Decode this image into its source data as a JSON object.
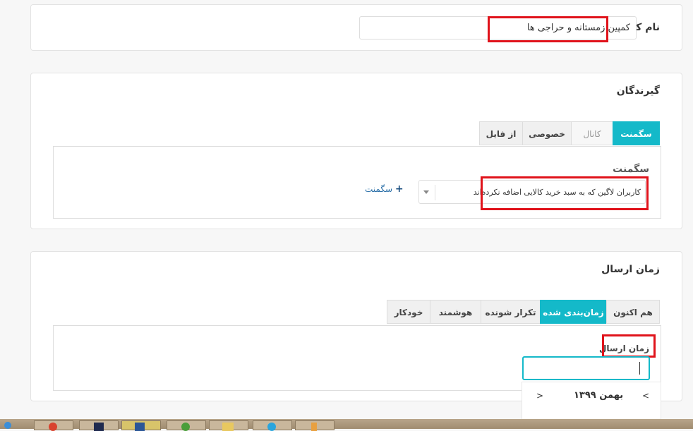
{
  "campaign": {
    "label": "نام کمپین",
    "value": "کمپین زمستانه و حراجی ها"
  },
  "recipients": {
    "title": "گیرندگان",
    "tabs": [
      {
        "label": "سگمنت",
        "state": "active"
      },
      {
        "label": "کانال",
        "state": "disabled"
      },
      {
        "label": "خصوصی",
        "state": "normal"
      },
      {
        "label": "از فایل",
        "state": "normal"
      }
    ],
    "segment_label": "سگمنت",
    "segment_value": "کاربران لاگین که به سبد خرید کالایی اضافه نکرده‌اند",
    "add_segment": "سگمنت"
  },
  "send_time": {
    "title": "زمان ارسال",
    "tabs": [
      {
        "label": "هم اکنون",
        "state": "normal"
      },
      {
        "label": "زمان‌بندی شده",
        "state": "active"
      },
      {
        "label": "تکرار شونده",
        "state": "normal"
      },
      {
        "label": "هوشمند",
        "state": "normal"
      },
      {
        "label": "خودکار",
        "state": "normal"
      }
    ],
    "field_label": "زمان ارسال",
    "datepicker": {
      "month": "بهمن ۱۳۹۹",
      "prev": "<",
      "next": ">"
    }
  },
  "colors": {
    "accent": "#14b9c9",
    "highlight": "#e0131b",
    "link": "#2a6fa8"
  }
}
